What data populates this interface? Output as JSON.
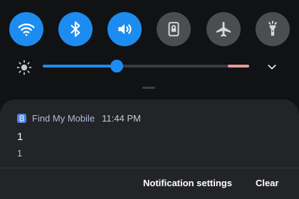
{
  "quick_settings": [
    {
      "name": "wifi",
      "icon": "wifi-icon",
      "active": true
    },
    {
      "name": "bluetooth",
      "icon": "bluetooth-icon",
      "active": true
    },
    {
      "name": "sound",
      "icon": "volume-icon",
      "active": true
    },
    {
      "name": "screen-lock",
      "icon": "rotation-lock-icon",
      "active": false
    },
    {
      "name": "airplane",
      "icon": "airplane-icon",
      "active": false
    },
    {
      "name": "flashlight",
      "icon": "flashlight-icon",
      "active": false
    }
  ],
  "brightness": {
    "level": 0.36,
    "icon": "brightness-icon",
    "expand_icon": "chevron-down-icon"
  },
  "notification": {
    "app_name": "Find My Mobile",
    "time": "11:44 PM",
    "title": "1",
    "text": "1",
    "actions": {
      "settings_label": "Notification settings",
      "clear_label": "Clear"
    }
  },
  "colors": {
    "accent": "#1c8cf0",
    "inactive": "#4b4d50",
    "card": "#232427",
    "background": "#111214"
  }
}
